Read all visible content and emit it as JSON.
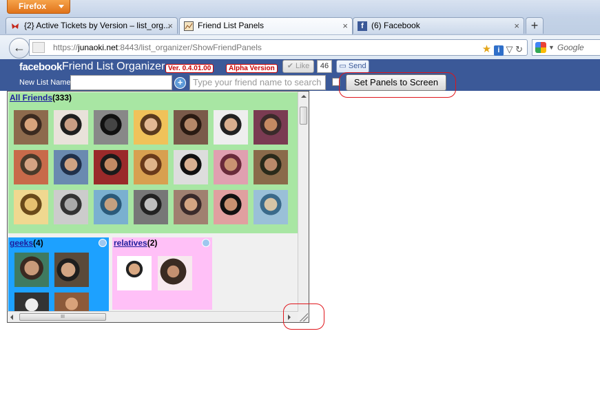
{
  "browser": {
    "menu_label": "Firefox",
    "tabs": [
      {
        "title": "{2} Active Tickets by Version – list_org...",
        "close": "×"
      },
      {
        "title": "Friend List Panels",
        "close": "×"
      },
      {
        "title": "(6) Facebook",
        "close": "×"
      }
    ],
    "newtab_label": "+",
    "back_label": "←",
    "url": {
      "scheme": "https://",
      "host": "junaoki.net",
      "rest": ":8443/list_organizer/ShowFriendPanels"
    },
    "search_placeholder": "Google"
  },
  "app": {
    "brand": "facebook",
    "title": "Friend List Organizer",
    "version_badge": "Ver. 0.4.01.00",
    "alpha_badge": "Alpha Version",
    "like_label": "✔ Like",
    "like_count": "46",
    "send_label": "Send",
    "new_list_label": "New List Name",
    "new_list_value": "",
    "friend_search_placeholder": "Type your friend name to search",
    "set_panels_label": "Set Panels to Screen"
  },
  "panels": {
    "all_friends": {
      "name": "All Friends",
      "count": "(333)"
    },
    "lists": [
      {
        "name": "geeks",
        "count": "(4)",
        "color": "#1da1ff"
      },
      {
        "name": "relatives",
        "count": "(2)",
        "color": "#ffc0f7"
      }
    ],
    "hscroll_grip": "III"
  },
  "colors": {
    "facebook_blue": "#3b5998",
    "all_friends_bg": "#a8e6a3",
    "annotation": "#e0141a"
  }
}
